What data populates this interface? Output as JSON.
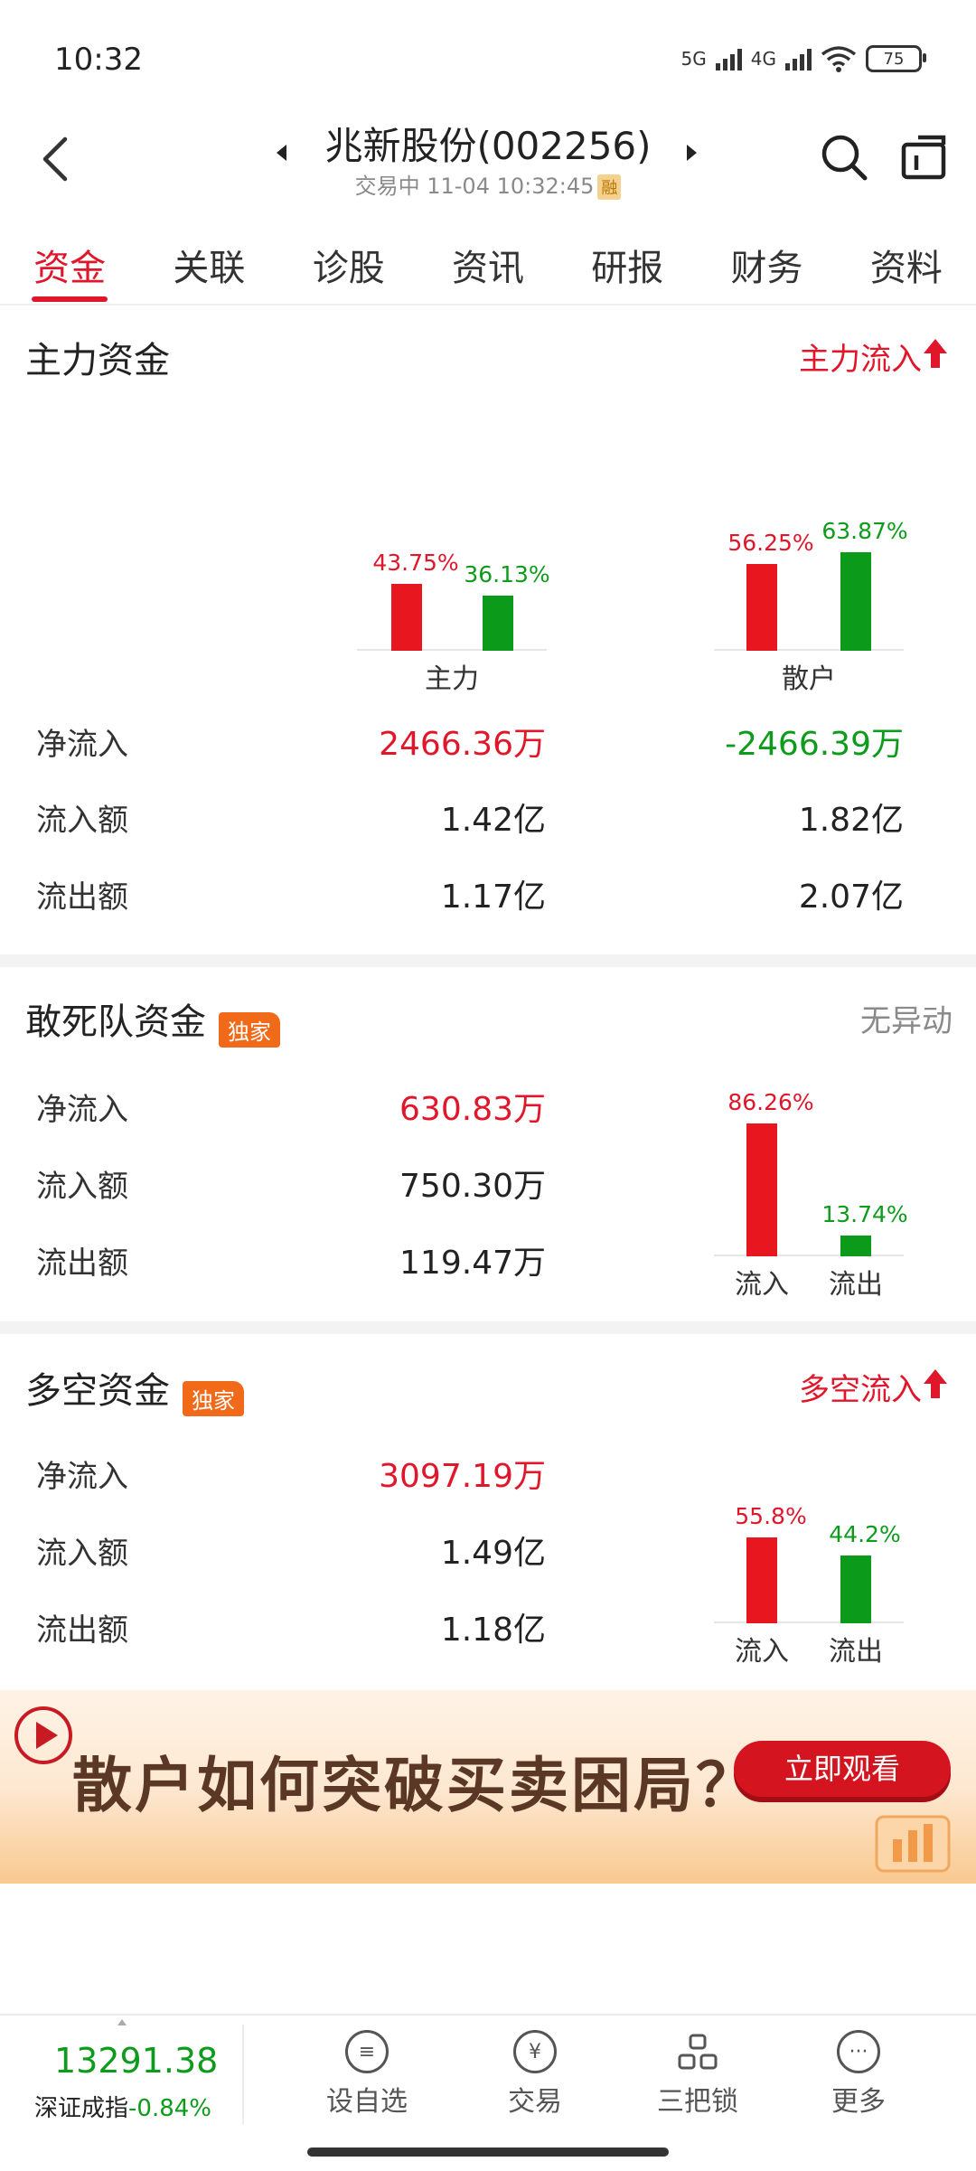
{
  "status": {
    "time": "10:32",
    "net1": "5G",
    "net2": "4G",
    "battery": "75"
  },
  "header": {
    "title": "兆新股份(002256)",
    "subtitle": "交易中 11-04 10:32:45",
    "subtitle_tag": "融"
  },
  "tabs": [
    "资金",
    "关联",
    "诊股",
    "资讯",
    "研报",
    "财务",
    "资料"
  ],
  "main_fund": {
    "title": "主力资金",
    "status": "主力流入",
    "charts": [
      {
        "name": "主力",
        "inflow_pct_label": "43.75%",
        "outflow_pct_label": "36.13%",
        "inflow_pct": 43.75,
        "outflow_pct": 36.13
      },
      {
        "name": "散户",
        "inflow_pct_label": "56.25%",
        "outflow_pct_label": "63.87%",
        "inflow_pct": 56.25,
        "outflow_pct": 63.87
      }
    ],
    "rows": [
      {
        "label": "净流入",
        "main": "2466.36万",
        "retail": "-2466.39万"
      },
      {
        "label": "流入额",
        "main": "1.42亿",
        "retail": "1.82亿"
      },
      {
        "label": "流出额",
        "main": "1.17亿",
        "retail": "2.07亿"
      }
    ]
  },
  "dare_fund": {
    "title": "敢死队资金",
    "badge": "独家",
    "status": "无异动",
    "rows": [
      {
        "label": "净流入",
        "value": "630.83万"
      },
      {
        "label": "流入额",
        "value": "750.30万"
      },
      {
        "label": "流出额",
        "value": "119.47万"
      }
    ],
    "chart": {
      "inflow_label": "流入",
      "outflow_label": "流出",
      "inflow_pct_label": "86.26%",
      "outflow_pct_label": "13.74%",
      "inflow_pct": 86.26,
      "outflow_pct": 13.74
    }
  },
  "longshort_fund": {
    "title": "多空资金",
    "badge": "独家",
    "status": "多空流入",
    "rows": [
      {
        "label": "净流入",
        "value": "3097.19万"
      },
      {
        "label": "流入额",
        "value": "1.49亿"
      },
      {
        "label": "流出额",
        "value": "1.18亿"
      }
    ],
    "chart": {
      "inflow_label": "流入",
      "outflow_label": "流出",
      "inflow_pct_label": "55.8%",
      "outflow_pct_label": "44.2%",
      "inflow_pct": 55.8,
      "outflow_pct": 44.2
    }
  },
  "banner": {
    "text": "散户如何突破买卖困局？",
    "button": "立即观看"
  },
  "bottom": {
    "index_value": "13291.38",
    "index_name": "深证成指",
    "index_change": "-0.84%",
    "nav": [
      {
        "label": "设自选",
        "icon": "list-icon"
      },
      {
        "label": "交易",
        "icon": "yuan-icon"
      },
      {
        "label": "三把锁",
        "icon": "locks-icon"
      },
      {
        "label": "更多",
        "icon": "more-icon"
      }
    ]
  },
  "colors": {
    "accent_red": "#e0162b",
    "inflow_red": "#e8161f",
    "outflow_green": "#0b9a1a"
  }
}
